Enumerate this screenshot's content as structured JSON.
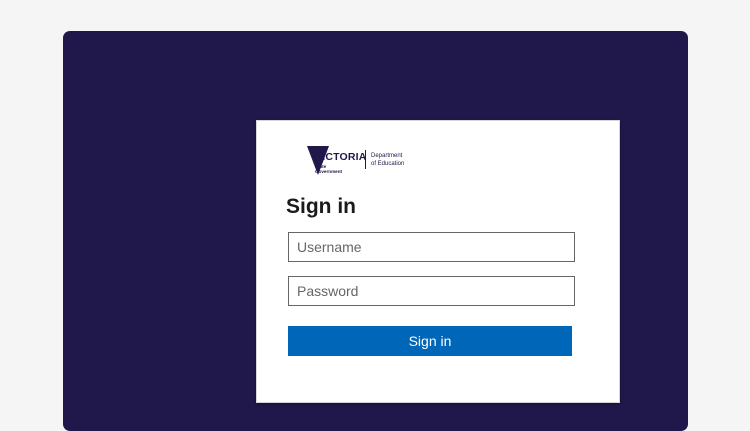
{
  "logo": {
    "wordmark": "VICTORIA",
    "sub_line1": "State",
    "sub_line2": "Government",
    "dept_line1": "Department",
    "dept_line2": "of Education"
  },
  "signin": {
    "title": "Sign in",
    "username_placeholder": "Username",
    "password_placeholder": "Password",
    "submit_label": "Sign in"
  },
  "colors": {
    "backdrop": "#20184a",
    "button": "#0067b8",
    "page_bg": "#f5f5f5"
  }
}
